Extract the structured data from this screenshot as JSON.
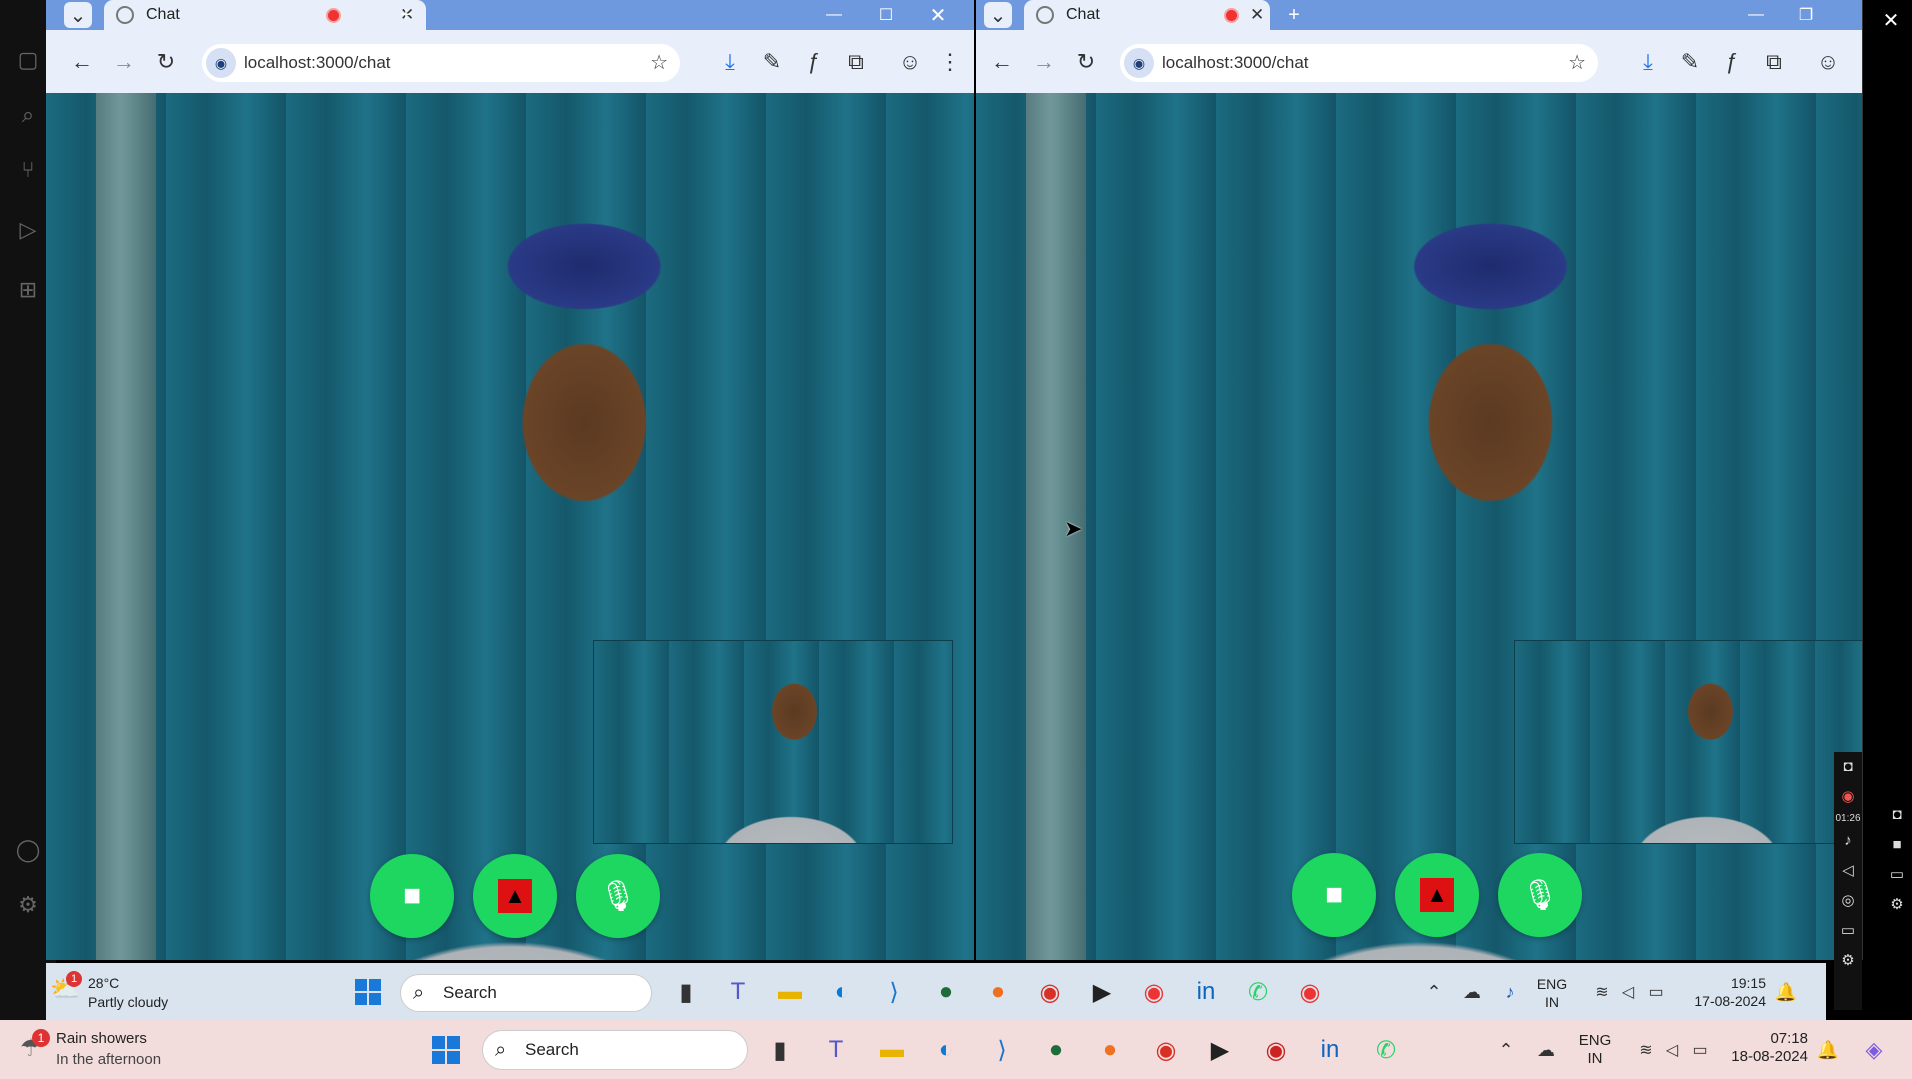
{
  "left_window": {
    "tab_title": "Chat",
    "url": "localhost:3000/chat"
  },
  "right_window": {
    "tab_title": "Chat",
    "url": "localhost:3000/chat"
  },
  "capture_bar": {
    "timer": "01:26"
  },
  "taskbar_inner": {
    "weather_temp": "28°C",
    "weather_desc": "Partly cloudy",
    "weather_badge": "1",
    "search_label": "Search",
    "lang": "ENG",
    "region": "IN",
    "time": "19:15",
    "date": "17-08-2024"
  },
  "taskbar_outer": {
    "weather_title": "Rain showers",
    "weather_desc": "In the afternoon",
    "weather_badge": "1",
    "search_label": "Search",
    "lang": "ENG",
    "region": "IN",
    "time": "07:18",
    "date": "18-08-2024"
  },
  "colors": {
    "accent_green": "#1ed760",
    "hangup_red": "#dd1111",
    "tab_strip": "#6f99df",
    "toolbar": "#e8effa"
  }
}
